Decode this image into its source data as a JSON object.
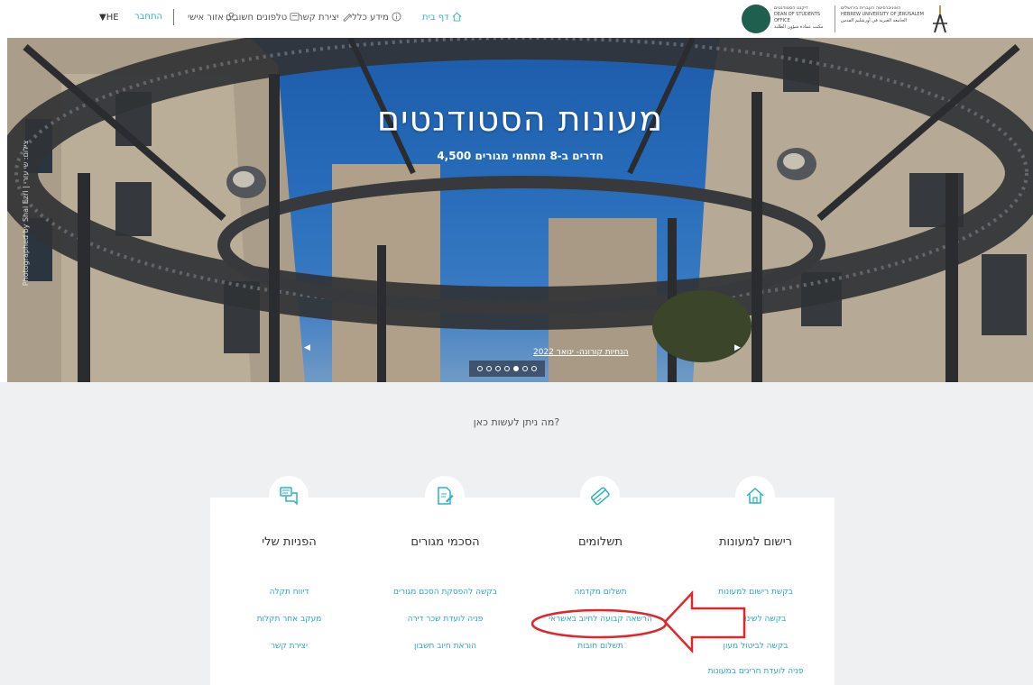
{
  "header": {
    "language": "▼HE",
    "nav": {
      "login": "התחבר",
      "personal_area": "אזור אישי",
      "important_phones": "טלפונים חשובים",
      "contact": "יצירת קשר",
      "general_info": "מידע כללי",
      "home": "דף בית"
    },
    "logos": {
      "dean_office": "דיקנט הסטודנטים\nDEAN OF STUDENTS OFFICE\nمكتب عمادة شؤون الطلبة",
      "university": "האוניברסיטה העברית בירושלים\nHEBREW UNIVERSITY OF JERUSALEM\nالجامعة العبرية في أورشليم القدس"
    }
  },
  "hero": {
    "title": "מעונות הסטודנטים",
    "subtitle": "4,500 חדרים ב-8 מתחמי מגורים",
    "photo_credit": "Photographed by Shai Ezri | צילום: שי עזרי",
    "slide_caption": "הנחיות קורונה- ינואר 2022",
    "prev_arrow": "◀",
    "next_arrow": "▶",
    "slide_count": 7,
    "active_slide": 5
  },
  "main": {
    "question": "מה ניתן לעשות כאן?",
    "cards": [
      {
        "icon": "speech-bubbles-icon",
        "title": "הפניות שלי",
        "links": [
          "דיווח תקלה",
          "מעקב אחר תקלות",
          "יצירת קשר"
        ]
      },
      {
        "icon": "document-edit-icon",
        "title": "הסכמי מגורים",
        "links": [
          "בקשה להפסקת הסכם מגורים",
          "פניה לועדת שכר דירה",
          "הוראת חיוב חשבון"
        ]
      },
      {
        "icon": "credit-card-icon",
        "title": "תשלומים",
        "links": [
          "תשלום מקדמה",
          "הרשאה קבועה לחיוב באשראי",
          "תשלום חובות"
        ]
      },
      {
        "icon": "house-icon",
        "title": "רישום למעונות",
        "links": [
          "בקשת רישום למעונות",
          "בקשה לשינוי מעון",
          "בקשה לביטול מעון",
          "פניה לועדת חריגים במעונות"
        ]
      }
    ]
  },
  "colors": {
    "accent": "#2bb3c0",
    "annotation": "#e0262b",
    "section_bg": "#eef0f2"
  }
}
